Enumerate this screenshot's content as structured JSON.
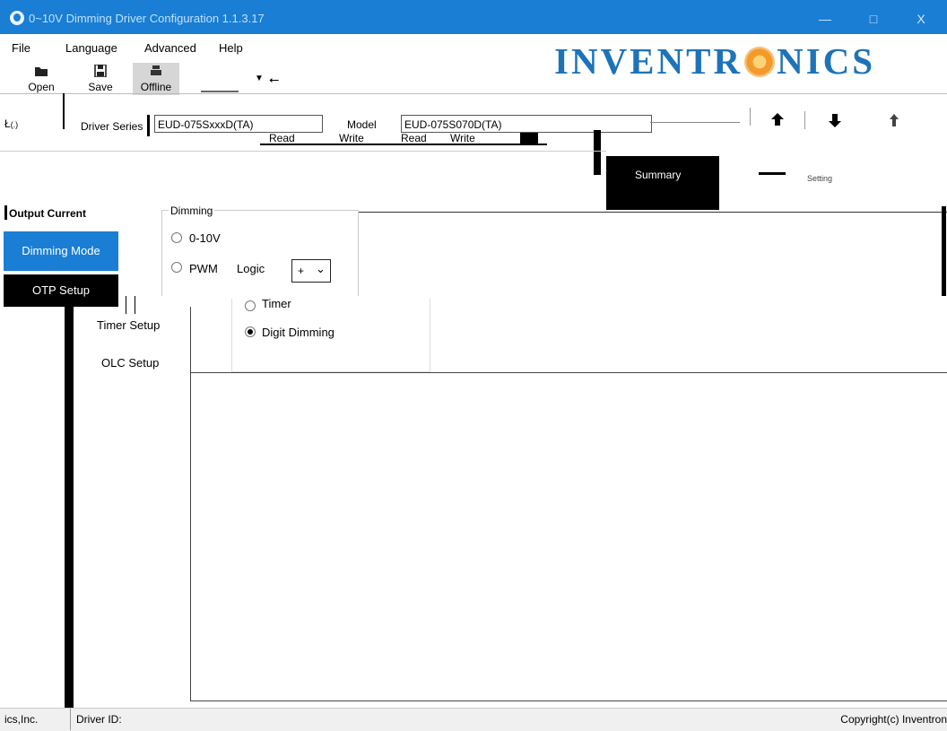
{
  "window": {
    "title": "0~10V Dimming Driver Configuration 1.1.3.17",
    "min_label": "—",
    "max_label": "□",
    "close_label": "X"
  },
  "menu": {
    "file": "File",
    "language": "Language",
    "advanced": "Advanced",
    "help": "Help"
  },
  "toolbar": {
    "open": "Open",
    "save": "Save",
    "offline": "Offline",
    "usb": "⭠"
  },
  "logo": {
    "left": "INVENTR",
    "right": "NICS"
  },
  "driver": {
    "series_label": "Driver Series",
    "series_value": "EUD-075SxxxD(TA)",
    "model_label": "Model",
    "model_value": "EUD-075S070D(TA)",
    "read": "Read",
    "write": "Write",
    "read2": "Read",
    "write2": "Write"
  },
  "summary": {
    "label": "Summary",
    "setting": "Setting"
  },
  "nav": {
    "output_current": "Output Current",
    "dimming_mode": "Dimming Mode",
    "otp_setup": "OTP Setup",
    "timer_setup": "Timer Setup",
    "olc_setup": "OLC Setup"
  },
  "dimming": {
    "group_title": "Dimming",
    "options": [
      {
        "label": "0-10V",
        "selected": false
      },
      {
        "label": "PWM",
        "selected": false
      },
      {
        "label": "Timer",
        "selected": false
      },
      {
        "label": "Digit Dimming",
        "selected": true
      }
    ],
    "logic_label": "Logic",
    "logic_value": "+",
    "logic_arrow": "⌄"
  },
  "status": {
    "left": "ics,Inc.",
    "driver_id_label": "Driver ID:",
    "copyright": "Copyright(c) Inventron"
  },
  "colors": {
    "titlebar": "#1a7ed4",
    "selected_nav": "#1a7ed4",
    "logo": "#1e73b8",
    "logo_sun": "#f39a2a"
  }
}
